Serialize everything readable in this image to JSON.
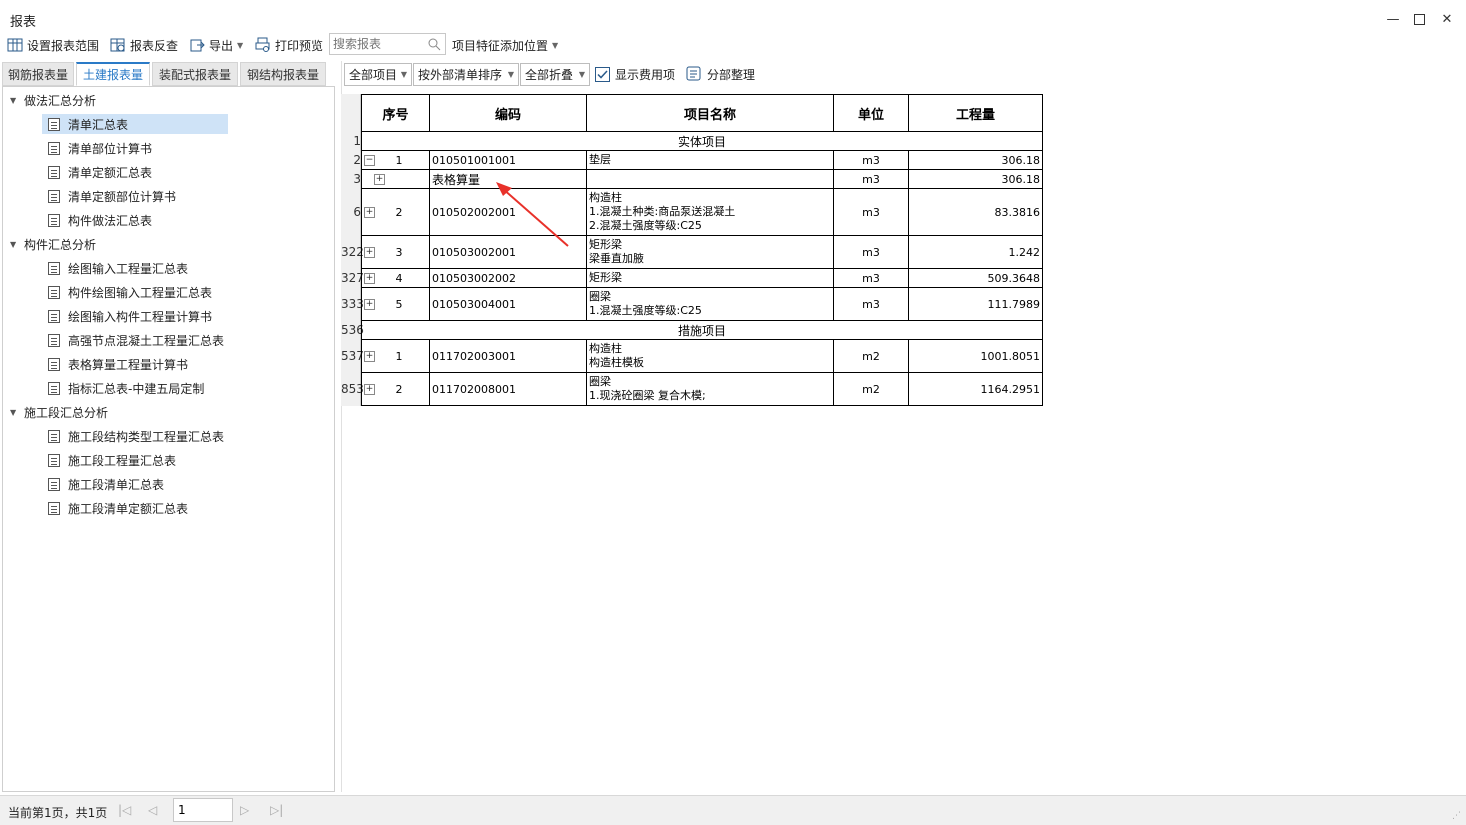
{
  "window": {
    "title": "报表"
  },
  "toolbar": {
    "set_range": "设置报表范围",
    "reverse_check": "报表反查",
    "export": "导出",
    "print_preview": "打印预览",
    "search_placeholder": "搜索报表",
    "feature_position": "项目特征添加位置"
  },
  "tabs": [
    "钢筋报表量",
    "土建报表量",
    "装配式报表量",
    "钢结构报表量"
  ],
  "active_tab": "土建报表量",
  "tree": {
    "group1": {
      "label": "做法汇总分析",
      "items": [
        "清单汇总表",
        "清单部位计算书",
        "清单定额汇总表",
        "清单定额部位计算书",
        "构件做法汇总表"
      ]
    },
    "group2": {
      "label": "构件汇总分析",
      "items": [
        "绘图输入工程量汇总表",
        "构件绘图输入工程量汇总表",
        "绘图输入构件工程量计算书",
        "高强节点混凝土工程量汇总表",
        "表格算量工程量计算书",
        "指标汇总表-中建五局定制"
      ]
    },
    "group3": {
      "label": "施工段汇总分析",
      "items": [
        "施工段结构类型工程量汇总表",
        "施工段工程量汇总表",
        "施工段清单汇总表",
        "施工段清单定额汇总表"
      ]
    },
    "selected": "清单汇总表"
  },
  "report_toolbar": {
    "all_items": "全部项目",
    "sort_by": "按外部清单排序",
    "collapse": "全部折叠",
    "show_fee": "显示费用项",
    "section_sort": "分部整理"
  },
  "table": {
    "headers": [
      "序号",
      "编码",
      "项目名称",
      "单位",
      "工程量"
    ],
    "section1": "实体项目",
    "section2": "措施项目",
    "rownums": {
      "r1": "1",
      "r2": "2",
      "r3": "3",
      "r6": "6",
      "r322": "322",
      "r327": "327",
      "r333": "333",
      "r536": "536",
      "r537": "537",
      "r853": "853"
    },
    "rows": [
      {
        "seq": "1",
        "code": "010501001001",
        "name": [
          "垫层"
        ],
        "unit": "m3",
        "qty": "306.18"
      },
      {
        "seq": "",
        "code": "表格算量",
        "name": [],
        "unit": "m3",
        "qty": "306.18"
      },
      {
        "seq": "2",
        "code": "010502002001",
        "name": [
          "构造柱",
          "1.混凝土种类:商品泵送混凝土",
          "2.混凝土强度等级:C25"
        ],
        "unit": "m3",
        "qty": "83.3816"
      },
      {
        "seq": "3",
        "code": "010503002001",
        "name": [
          "矩形梁",
          "梁垂直加腋"
        ],
        "unit": "m3",
        "qty": "1.242"
      },
      {
        "seq": "4",
        "code": "010503002002",
        "name": [
          "矩形梁"
        ],
        "unit": "m3",
        "qty": "509.3648"
      },
      {
        "seq": "5",
        "code": "010503004001",
        "name": [
          "圈梁",
          "1.混凝土强度等级:C25"
        ],
        "unit": "m3",
        "qty": "111.7989"
      },
      {
        "seq": "1",
        "code": "011702003001",
        "name": [
          "构造柱",
          "构造柱模板"
        ],
        "unit": "m2",
        "qty": "1001.8051"
      },
      {
        "seq": "2",
        "code": "011702008001",
        "name": [
          "圈梁",
          "1.现浇砼圈梁 复合木模;"
        ],
        "unit": "m2",
        "qty": "1164.2951"
      }
    ]
  },
  "status": {
    "page_info": "当前第1页，共1页",
    "page_value": "1"
  },
  "colors": {
    "accent": "#2a7ac7",
    "selected_bg": "#cfe3f7",
    "arrow": "#e8312a"
  }
}
